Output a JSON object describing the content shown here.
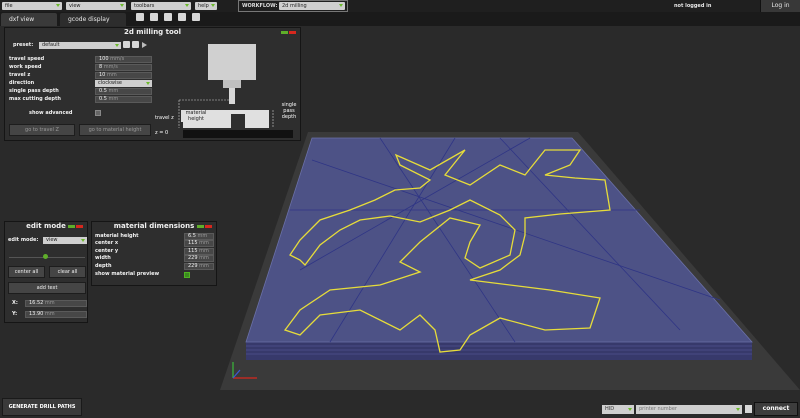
{
  "menubar": {
    "menus": [
      "file",
      "view",
      "toolbars",
      "help"
    ],
    "workflow_label": "WORKFLOW:",
    "workflow_value": "2d milling",
    "login_status": "not logged in",
    "login_button": "Log in"
  },
  "tabs": [
    "dxf view",
    "gcode display"
  ],
  "toolbar_icons": [
    "save-icon",
    "open-icon",
    "export-icon",
    "print-icon",
    "settings-icon"
  ],
  "milling_tool": {
    "title": "2d milling tool",
    "preset_label": "preset:",
    "preset_value": "default",
    "fields": [
      {
        "label": "travel speed",
        "value": "100",
        "unit": "mm/s"
      },
      {
        "label": "work speed",
        "value": "8",
        "unit": "mm/s"
      },
      {
        "label": "travel z",
        "value": "10",
        "unit": "mm"
      },
      {
        "label": "direction",
        "value": "clockwise",
        "type": "select"
      },
      {
        "label": "single pass depth",
        "value": "0.5",
        "unit": "mm"
      },
      {
        "label": "max cutting depth",
        "value": "0.5",
        "unit": "mm"
      }
    ],
    "show_advanced_label": "show advanced",
    "go_travel_z": "go to travel Z",
    "go_material_height": "go to material height",
    "diagram": {
      "travel_z": "travel z",
      "material_height": "material height",
      "single_pass_depth": "single pass depth",
      "z0": "z = 0"
    }
  },
  "edit_mode": {
    "title": "edit mode",
    "mode_label": "edit mode:",
    "mode_value": "view",
    "center_all": "center all",
    "clear_all": "clear all",
    "add_text": "add text",
    "x_label": "X:",
    "x_value": "16.52",
    "y_label": "Y:",
    "y_value": "13.90",
    "unit": "mm"
  },
  "material": {
    "title": "material dimensions",
    "fields": [
      {
        "label": "material height",
        "value": "6.5",
        "unit": "mm"
      },
      {
        "label": "center x",
        "value": "115",
        "unit": "mm"
      },
      {
        "label": "center y",
        "value": "115",
        "unit": "mm"
      },
      {
        "label": "width",
        "value": "229",
        "unit": "mm"
      },
      {
        "label": "depth",
        "value": "229",
        "unit": "mm"
      }
    ],
    "preview_label": "show material preview",
    "preview_checked": true
  },
  "bottom": {
    "generate": "GENERATE DRILL PATHS",
    "port_type": "HID",
    "printer_placeholder": "printer number",
    "connect": "connect"
  },
  "colors": {
    "accent_green": "#5fae2a",
    "close_red": "#d6281e",
    "board_top": "#4d5286",
    "toolpath": "#e6dc3a"
  }
}
